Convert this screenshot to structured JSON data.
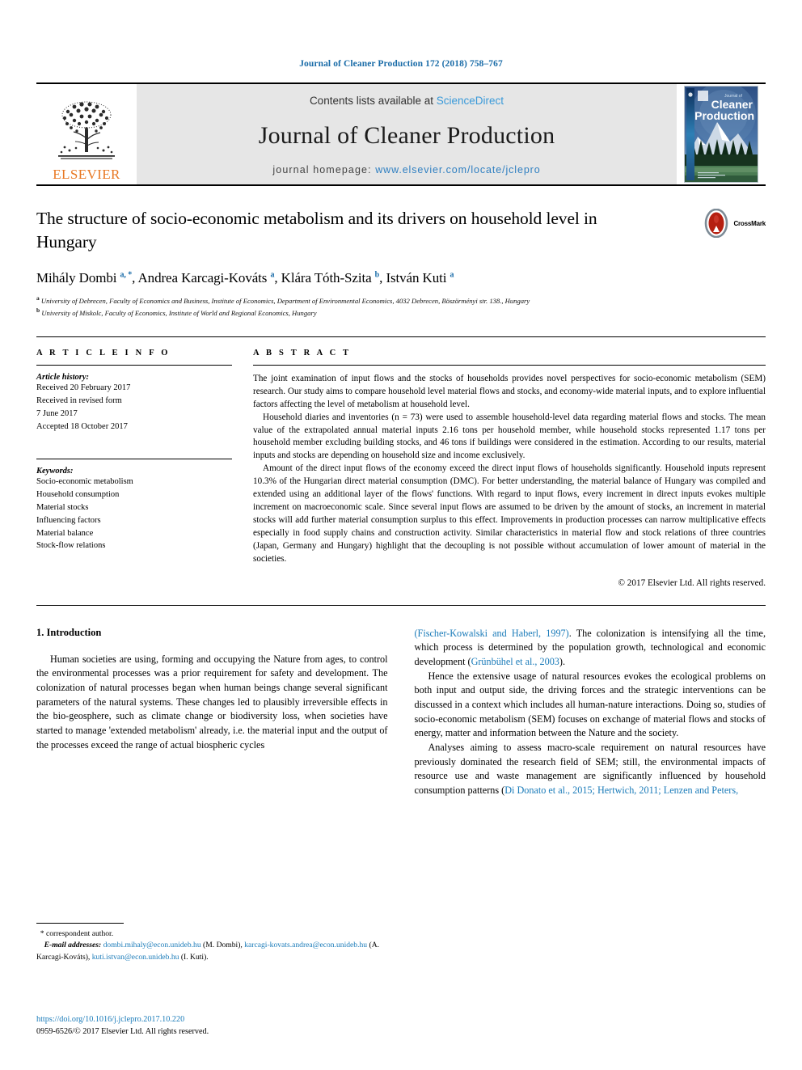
{
  "running_head": "Journal of Cleaner Production 172 (2018) 758–767",
  "banner": {
    "publisher_name": "ELSEVIER",
    "contents_prefix": "Contents lists available at ",
    "contents_link": "ScienceDirect",
    "journal_title": "Journal of Cleaner Production",
    "homepage_prefix": "journal homepage: ",
    "homepage_url": "www.elsevier.com/locate/jclepro",
    "cover_kicker": "Journal of",
    "cover_title_line1": "Cleaner",
    "cover_title_line2": "Production",
    "link_color": "#3a9ad9",
    "elsevier_orange": "#e87722"
  },
  "article": {
    "title": "The structure of socio-economic metabolism and its drivers on household level in Hungary",
    "crossmark_label": "CrossMark",
    "authors_html": "Mihály Dombi <sup>a, *</sup>, Andrea Karcagi-Kováts <sup>a</sup>, Klára Tóth-Szita <sup>b</sup>, István Kuti <sup>a</sup>",
    "affiliation_a": "University of Debrecen, Faculty of Economics and Business, Institute of Economics, Department of Environmental Economics, 4032 Debrecen, Böszörményi str. 138., Hungary",
    "affiliation_b": "University of Miskolc, Faculty of Economics, Institute of World and Regional Economics, Hungary"
  },
  "article_info": {
    "heading": "A R T I C L E   I N F O",
    "history_label": "Article history:",
    "history": [
      "Received 20 February 2017",
      "Received in revised form",
      "7 June 2017",
      "Accepted 18 October 2017"
    ],
    "keywords_label": "Keywords:",
    "keywords": [
      "Socio-economic metabolism",
      "Household consumption",
      "Material stocks",
      "Influencing factors",
      "Material balance",
      "Stock-flow relations"
    ]
  },
  "abstract": {
    "heading": "A B S T R A C T",
    "paragraphs": [
      "The joint examination of input flows and the stocks of households provides novel perspectives for socio-economic metabolism (SEM) research. Our study aims to compare household level material flows and stocks, and economy-wide material inputs, and to explore influential factors affecting the level of metabolism at household level.",
      "Household diaries and inventories (n = 73) were used to assemble household-level data regarding material flows and stocks. The mean value of the extrapolated annual material inputs 2.16 tons per household member, while household stocks represented 1.17 tons per household member excluding building stocks, and 46 tons if buildings were considered in the estimation. According to our results, material inputs and stocks are depending on household size and income exclusively.",
      "Amount of the direct input flows of the economy exceed the direct input flows of households significantly. Household inputs represent 10.3% of the Hungarian direct material consumption (DMC). For better understanding, the material balance of Hungary was compiled and extended using an additional layer of the flows' functions. With regard to input flows, every increment in direct inputs evokes multiple increment on macroeconomic scale. Since several input flows are assumed to be driven by the amount of stocks, an increment in material stocks will add further material consumption surplus to this effect. Improvements in production processes can narrow multiplicative effects especially in food supply chains and construction activity. Similar characteristics in material flow and stock relations of three countries (Japan, Germany and Hungary) highlight that the decoupling is not possible without accumulation of lower amount of material in the societies."
    ],
    "copyright": "© 2017 Elsevier Ltd. All rights reserved."
  },
  "body": {
    "section_number_title": "1. Introduction",
    "left_paragraph": "Human societies are using, forming and occupying the Nature from ages, to control the environmental processes was a prior requirement for safety and development. The colonization of natural processes began when human beings change several significant parameters of the natural systems. These changes led to plausibly irreversible effects in the bio-geosphere, such as climate change or biodiversity loss, when societies have started to manage 'extended metabolism' already, i.e. the material input and the output of the processes exceed the range of actual biospheric cycles",
    "right_para1_cite1": "(Fischer-Kowalski and Haberl, 1997)",
    "right_para1_mid": ". The colonization is intensifying all the time, which process is determined by the population growth, technological and economic development (",
    "right_para1_cite2": "Grünbühel et al., 2003",
    "right_para1_end": ").",
    "right_para2": "Hence the extensive usage of natural resources evokes the ecological problems on both input and output side, the driving forces and the strategic interventions can be discussed in a context which includes all human-nature interactions. Doing so, studies of socio-economic metabolism (SEM) focuses on exchange of material flows and stocks of energy, matter and information between the Nature and the society.",
    "right_para3_start": "Analyses aiming to assess macro-scale requirement on natural resources have previously dominated the research field of SEM; still, the environmental impacts of resource use and waste management are significantly influenced by household consumption patterns (",
    "right_para3_cite": "Di Donato et al., 2015; Hertwich, 2011; Lenzen and Peters,",
    "cite_color": "#1a7bb9"
  },
  "footnotes": {
    "correspondent": "* correspondent author.",
    "email_label": "E-mail addresses:",
    "email_1": "dombi.mihaly@econ.unideb.hu",
    "email_1_owner": "(M. Dombi),",
    "email_2": "karcagi-kovats.andrea@econ.unideb.hu",
    "email_2_owner": "(A. Karcagi-Kováts),",
    "email_3": "kuti.istvan@econ.unideb.hu",
    "email_3_owner": "(I. Kuti).",
    "doi": "https://doi.org/10.1016/j.jclepro.2017.10.220",
    "issn": "0959-6526/© 2017 Elsevier Ltd. All rights reserved."
  }
}
